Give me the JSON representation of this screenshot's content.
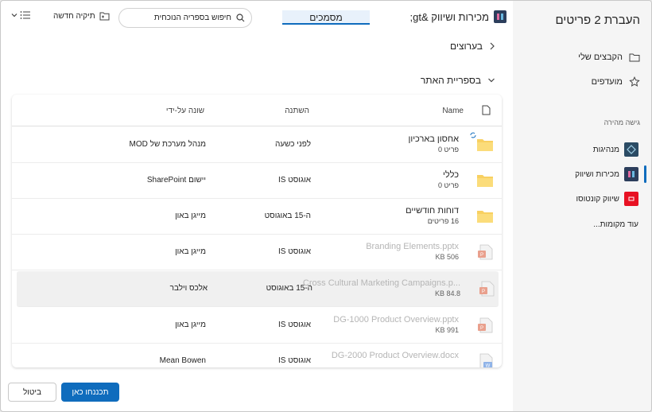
{
  "nav": {
    "title": "העברת 2 פריטים",
    "items": [
      {
        "label": "הקבצים שלי",
        "icon": "folder-icon"
      },
      {
        "label": "מועדפים",
        "icon": "star-icon"
      }
    ],
    "quick_access_label": "גישה מהירה",
    "sites": [
      {
        "label": "מנהיגות",
        "color": "#2b4b64"
      },
      {
        "label": "מכירות ושיווק",
        "color": "#2c3e5c"
      },
      {
        "label": "שיווק קונטוסו",
        "color": "#e81123"
      }
    ],
    "more_places": "עוד מקומות..."
  },
  "header": {
    "site_title": "מכירות ושיווק &gt;",
    "documents": "מסמכים",
    "search_placeholder": "חיפוש בספריה הנוכחית",
    "new_folder": "תיקיה חדשה"
  },
  "breadcrumb": {
    "label": "בערוצים"
  },
  "library_section": {
    "label": "בספריית האתר"
  },
  "table": {
    "columns": {
      "name": "Name",
      "modified": "השתנה",
      "modified_by": "שונה על-ידי"
    },
    "rows": [
      {
        "name": "אחסון בארכיון",
        "sub": "פריט 0",
        "modified": "לפני כשעה",
        "modified_by": "מנהל מערכת של MOD",
        "type": "folder",
        "dim": false
      },
      {
        "name": "כללי",
        "sub": "פריט 0",
        "modified": "אוגוסט IS",
        "modified_by": "יישום SharePoint",
        "type": "folder",
        "dim": false
      },
      {
        "name": "דוחות חודשיים",
        "sub": "16 פריטים",
        "modified": "ה-15 באוגוסט",
        "modified_by": "מייגן באון",
        "type": "folder",
        "dim": false
      },
      {
        "name": "Branding Elements.pptx",
        "sub": "506 KB",
        "modified": "אוגוסט IS",
        "modified_by": "מייגן באון",
        "type": "pptx",
        "dim": true
      },
      {
        "name": "Cross Cultural Marketing Campaigns.p...",
        "sub": "84.8 KB",
        "modified": "ה-15 באוגוסט",
        "modified_by": "אלכס וילבר",
        "type": "pptx",
        "dim": true
      },
      {
        "name": "DG-1000 Product Overview.pptx",
        "sub": "991 KB",
        "modified": "אוגוסט IS",
        "modified_by": "מייגן באון",
        "type": "pptx",
        "dim": true
      },
      {
        "name": "DG-2000 Product Overview.docx",
        "sub": "",
        "modified": "אוגוסט IS",
        "modified_by": "Mean Bowen",
        "type": "docx",
        "dim": true
      }
    ]
  },
  "buttons": {
    "primary": "תכננחו כאן",
    "secondary": "ביטול"
  }
}
